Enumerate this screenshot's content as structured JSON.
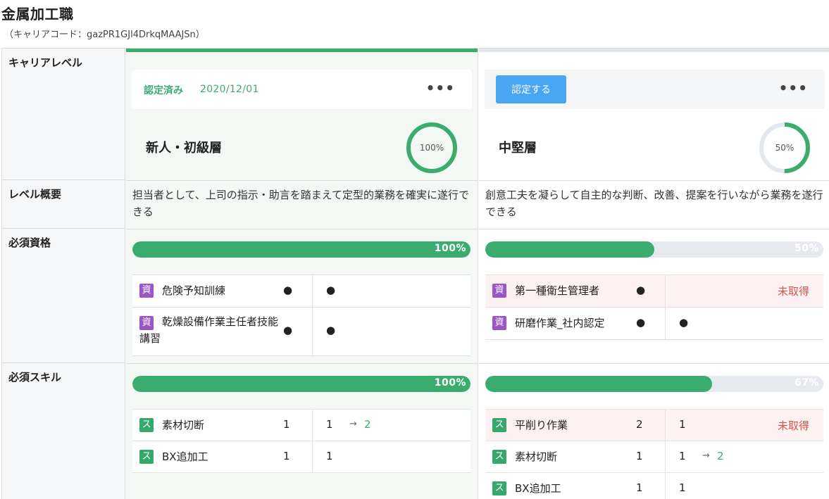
{
  "page": {
    "title": "金属加工職",
    "code": "（キャリアコード：gazPR1GJl4DrkqMAAJSn）"
  },
  "row_headers": {
    "career_level": "キャリアレベル",
    "overview": "レベル概要",
    "qualifications": "必須資格",
    "skills": "必須スキル"
  },
  "colors": {
    "accent": "#3aac6e",
    "button": "#48a6f5",
    "qual_badge": "#9c55c6",
    "skill_badge": "#35a86b",
    "missing": "#d9534f"
  },
  "levels": [
    {
      "status_label": "認定済み",
      "status_date": "2020/12/01",
      "menu": "•••",
      "name": "新人・初級層",
      "progress": 100,
      "progress_label": "100%",
      "summary": "担当者として、上司の指示・助言を踏まえて定型的業務を確実に遂行できる",
      "qual_progress": 100,
      "qual_label": "100%",
      "qualifications": [
        {
          "badge": "資",
          "name": "危険予知訓練",
          "required": "●",
          "current": "●"
        },
        {
          "badge": "資",
          "name": "乾燥設備作業主任者技能講習",
          "required": "●",
          "current": "●"
        }
      ],
      "skill_progress": 100,
      "skill_label": "100%",
      "skills": [
        {
          "badge": "ス",
          "name": "素材切断",
          "required": "1",
          "current": "1",
          "arrow": "→",
          "target": "2"
        },
        {
          "badge": "ス",
          "name": "BX追加工",
          "required": "1",
          "current": "1"
        }
      ]
    },
    {
      "button_label": "認定する",
      "menu": "•••",
      "name": "中堅層",
      "progress": 50,
      "progress_label": "50%",
      "summary": "創意工夫を凝らして自主的な判断、改善、提案を行いながら業務を遂行できる",
      "qual_progress": 50,
      "qual_label": "50%",
      "qualifications": [
        {
          "badge": "資",
          "name": "第一種衛生管理者",
          "required": "●",
          "missing": "未取得"
        },
        {
          "badge": "資",
          "name": "研磨作業_社内認定",
          "required": "●",
          "current": "●"
        }
      ],
      "skill_progress": 67,
      "skill_label": "67%",
      "skills": [
        {
          "badge": "ス",
          "name": "平削り作業",
          "required": "2",
          "current": "1",
          "missing": "未取得"
        },
        {
          "badge": "ス",
          "name": "素材切断",
          "required": "1",
          "current": "1",
          "arrow": "→",
          "target": "2"
        },
        {
          "badge": "ス",
          "name": "BX追加工",
          "required": "1",
          "current": "1"
        }
      ]
    }
  ]
}
